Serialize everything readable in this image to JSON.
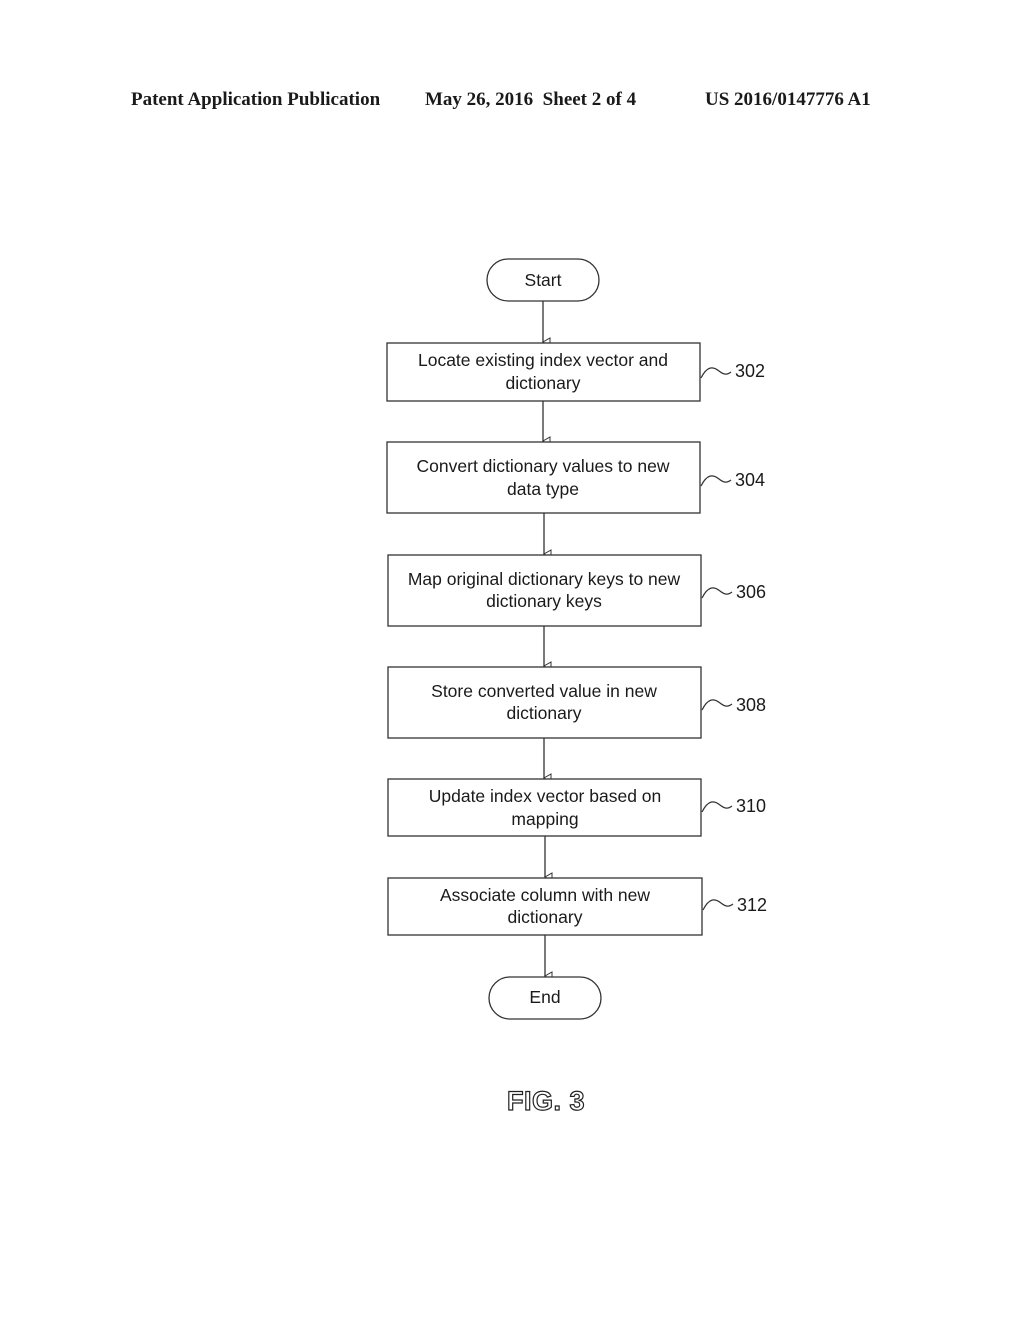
{
  "header": {
    "publication_type": "Patent Application Publication",
    "date_sheet": "May 26, 2016  Sheet 2 of 4",
    "publication_number": "US 2016/0147776 A1"
  },
  "flowchart": {
    "start_label": "Start",
    "end_label": "End",
    "steps": [
      {
        "ref": "302",
        "lines": [
          "Locate existing index vector and",
          "dictionary"
        ]
      },
      {
        "ref": "304",
        "lines": [
          "Convert dictionary values to new",
          "data type"
        ]
      },
      {
        "ref": "306",
        "lines": [
          "Map original dictionary keys to new",
          "dictionary keys"
        ]
      },
      {
        "ref": "308",
        "lines": [
          "Store converted value in new",
          "dictionary"
        ]
      },
      {
        "ref": "310",
        "lines": [
          "Update index vector based on",
          "mapping"
        ]
      },
      {
        "ref": "312",
        "lines": [
          "Associate column with new",
          "dictionary"
        ]
      }
    ]
  },
  "figure_label": "FIG. 3"
}
